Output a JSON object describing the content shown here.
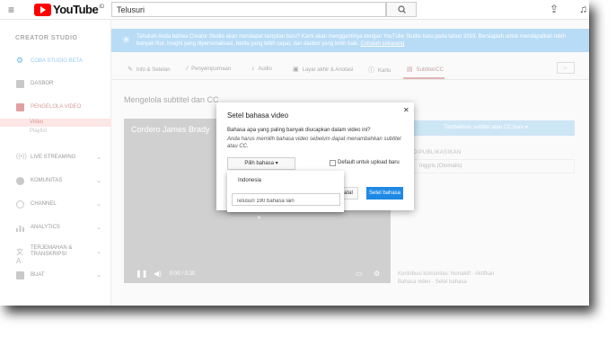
{
  "header": {
    "brand": "YouTube",
    "country_code": "ID",
    "search_value": "Telusuri",
    "search_button_icon": "search-icon"
  },
  "sidebar": {
    "section_title": "CREATOR STUDIO",
    "items": [
      {
        "label": "COBA STUDIO BETA",
        "icon": "gear-icon"
      },
      {
        "label": "DASBOR",
        "icon": "dashboard-icon"
      },
      {
        "label": "PENGELOLA VIDEO",
        "icon": "video-manager-icon"
      },
      {
        "label": "LIVE STREAMING",
        "icon": "live-icon"
      },
      {
        "label": "KOMUNITAS",
        "icon": "community-icon"
      },
      {
        "label": "CHANNEL",
        "icon": "channel-icon"
      },
      {
        "label": "ANALYTICS",
        "icon": "analytics-icon"
      },
      {
        "label": "TERJEMAHAN &",
        "label2": "TRANSKRIPSI",
        "icon": "translate-icon"
      },
      {
        "label": "BUAT",
        "icon": "create-icon"
      }
    ],
    "subitems": [
      {
        "label": "Video",
        "active": true
      },
      {
        "label": "Playlist",
        "active": false
      }
    ]
  },
  "notice": {
    "text": "Tahukah Anda bahwa Creator Studio akan mendapat tampilan baru? Kami akan menggantinya dengan YouTube Studio baru pada tahun 2019. Bersiaplah untuk mendapatkan lebih banyak fitur, insight yang dipersonalisasi, berita yang lebih cepat, dan dasbor yang lebih baik.",
    "link": "Cobalah sekarang"
  },
  "tabs": [
    {
      "label": "Info & Setelan",
      "icon": "pencil-icon"
    },
    {
      "label": "Penyempurnaan",
      "icon": "wand-icon"
    },
    {
      "label": "Audio",
      "icon": "music-icon"
    },
    {
      "label": "Layar akhir & Anotasi",
      "icon": "endscreen-icon"
    },
    {
      "label": "Kartu",
      "icon": "info-icon"
    },
    {
      "label": "Subtitel/CC",
      "icon": "subtitles-icon",
      "active": true
    }
  ],
  "main": {
    "page_title": "Mengelola subtitel dan CC",
    "video_title": "Cordero James Brady",
    "time": "0:00 / 0:30",
    "add_subtitle_button": "Tambahkan subtitel atau CC baru ▾",
    "field_label": "DIPUBLIKASIKAN",
    "field_value": "Inggris (Otomatis)",
    "footer_line1": "Kontribusi komunitas: Nonaktif · Aktifkan",
    "footer_line2": "Bahasa video · Setel bahasa"
  },
  "dialog": {
    "title": "Setel bahasa video",
    "question": "Bahasa apa yang paling banyak diucapkan dalam video ini?",
    "hint": "Anda harus memilih bahasa video sebelum dapat menambahkan subtitel atau CC.",
    "pick_label": "Pilih bahasa ▾",
    "checkbox_label": "Default untuk upload baru",
    "cancel_label": "Batal",
    "set_label": "Setel bahasa"
  },
  "dropdown": {
    "option": "Indonesia",
    "search_value": "Telusuri 190 bahasa lain"
  },
  "colors": {
    "accent": "#1e88e5",
    "notice": "#b9dcf6",
    "brand_red": "#ff0000"
  }
}
